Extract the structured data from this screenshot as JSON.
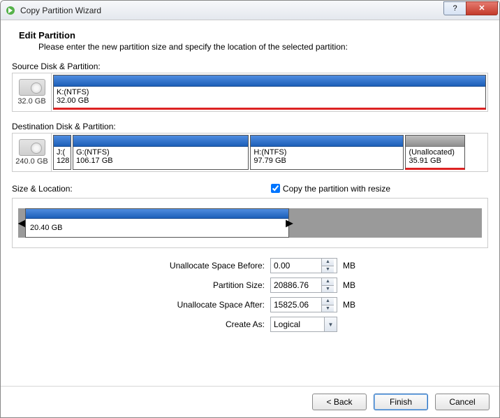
{
  "window": {
    "title": "Copy Partition Wizard",
    "help_glyph": "?",
    "close_glyph": "✕"
  },
  "header": {
    "title": "Edit Partition",
    "subtitle": "Please enter the new partition size and specify the location of the selected partition:"
  },
  "source": {
    "label": "Source Disk & Partition:",
    "disk_size": "32.0 GB",
    "partitions": [
      {
        "name": "K:(NTFS)",
        "size": "32.00 GB",
        "width_pct": 100,
        "red_bottom": true,
        "unalloc": false
      }
    ]
  },
  "destination": {
    "label": "Destination Disk & Partition:",
    "disk_size": "240.0 GB",
    "partitions": [
      {
        "name": "J:(",
        "size": "128",
        "width_pct": 4.2,
        "red_bottom": false,
        "unalloc": false
      },
      {
        "name": "G:(NTFS)",
        "size": "106.17 GB",
        "width_pct": 40.7,
        "red_bottom": false,
        "unalloc": false
      },
      {
        "name": "H:(NTFS)",
        "size": "97.79 GB",
        "width_pct": 35.5,
        "red_bottom": false,
        "unalloc": false
      },
      {
        "name": "(Unallocated)",
        "size": "35.91 GB",
        "width_pct": 13.8,
        "red_bottom": true,
        "unalloc": true
      }
    ]
  },
  "sizeloc": {
    "label": "Size & Location:",
    "checkbox_label": "Copy the partition with resize",
    "checked": true
  },
  "resize": {
    "filled_label": "20.40 GB",
    "filled_pct": 57,
    "left_handle": "◄",
    "right_handle": "►"
  },
  "form": {
    "unalloc_before_label": "Unallocate Space Before:",
    "unalloc_before_value": "0.00",
    "partition_size_label": "Partition Size:",
    "partition_size_value": "20886.76",
    "unalloc_after_label": "Unallocate Space After:",
    "unalloc_after_value": "15825.06",
    "unit": "MB",
    "create_as_label": "Create As:",
    "create_as_value": "Logical"
  },
  "footer": {
    "back": "< Back",
    "finish": "Finish",
    "cancel": "Cancel"
  }
}
